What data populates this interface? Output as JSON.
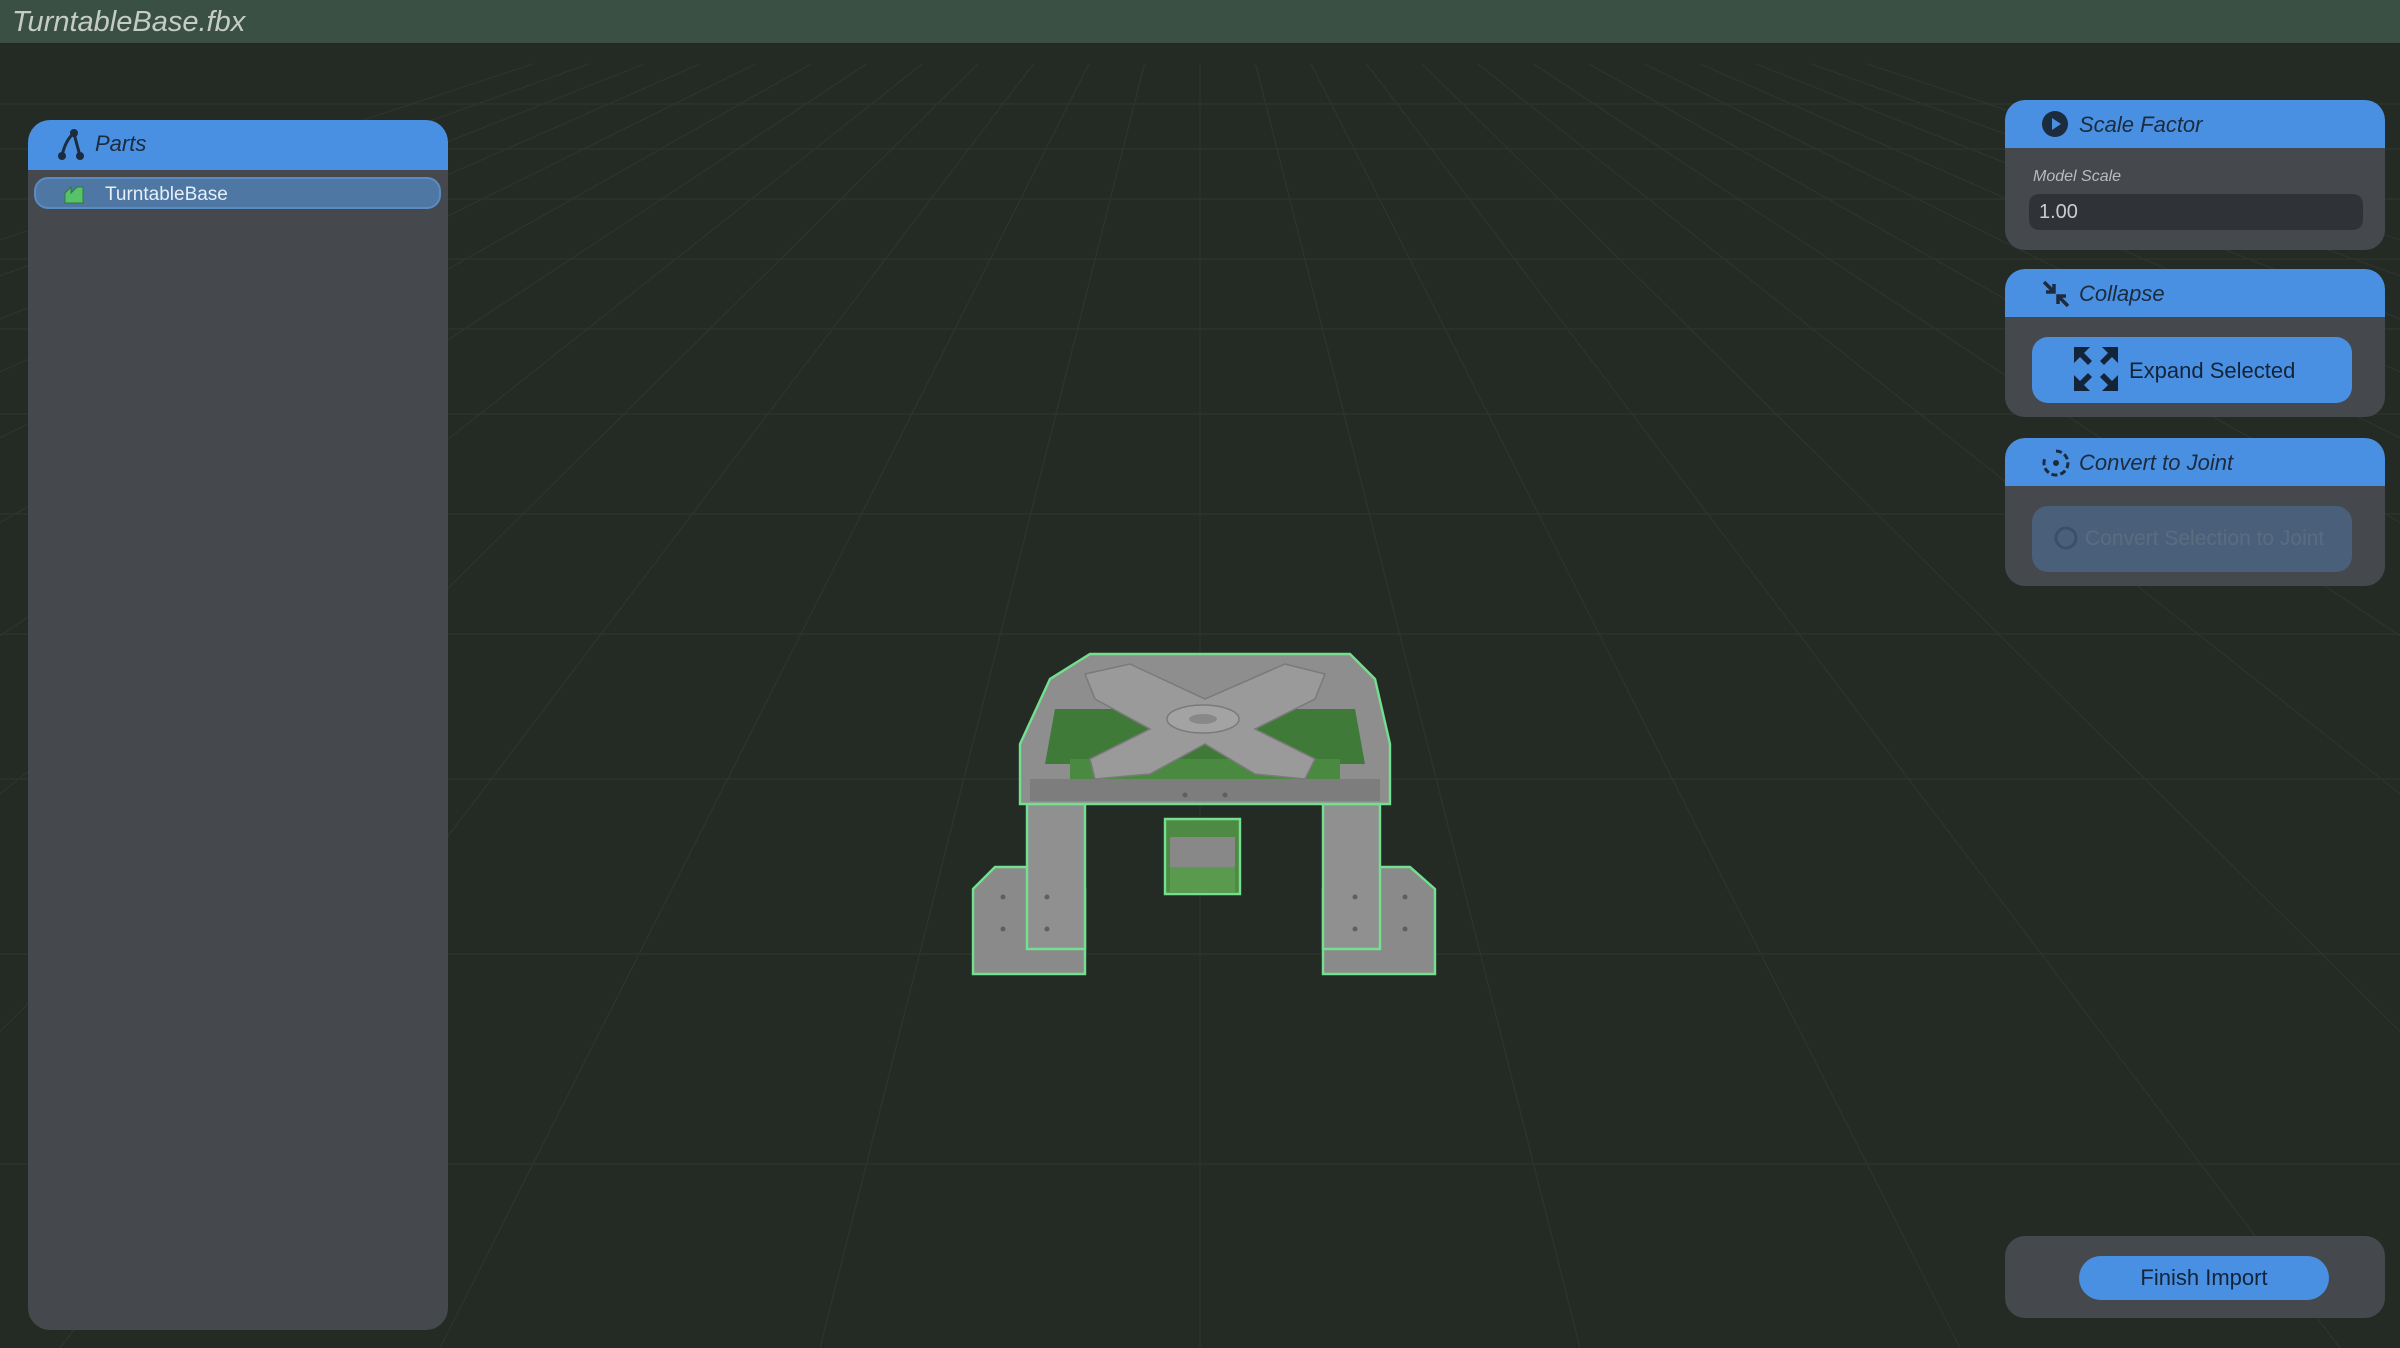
{
  "window": {
    "title": "TurntableBase.fbx"
  },
  "parts_panel": {
    "header_label": "Parts",
    "header_icon": "hierarchy-icon",
    "items": [
      {
        "label": "TurntableBase",
        "icon": "model-part-icon",
        "selected": true
      }
    ]
  },
  "scale_factor": {
    "header_label": "Scale Factor",
    "header_icon": "play-circle-icon",
    "field_label": "Model Scale",
    "field_value": "1.00"
  },
  "collapse": {
    "header_label": "Collapse",
    "header_icon": "collapse-arrows-icon",
    "button_label": "Expand Selected",
    "button_icon": "expand-arrows-icon"
  },
  "convert_to_joint": {
    "header_label": "Convert to Joint",
    "header_icon": "rotate-joint-icon",
    "button_label": "Convert Selection to Joint",
    "button_enabled": false
  },
  "finish": {
    "button_label": "Finish Import"
  },
  "colors": {
    "accent": "#4a90e2",
    "panel": "#45494d",
    "viewport": "#242a24",
    "titlebar": "#3a5044",
    "selection_outline": "#6fe08a"
  }
}
